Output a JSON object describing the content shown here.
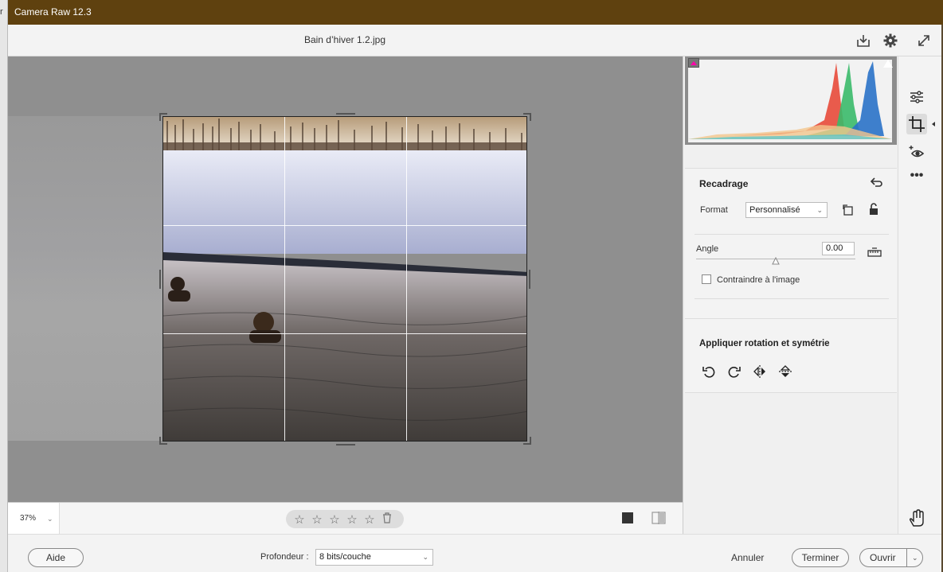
{
  "title_bar": {
    "app_title": "Camera Raw 12.3",
    "edge_char": "r"
  },
  "header": {
    "filename": "Bain d’hiver 1.2.jpg"
  },
  "status": {
    "zoom": "37%",
    "rating_stars": 0
  },
  "crop_panel": {
    "title": "Recadrage",
    "format_label": "Format",
    "format_value": "Personnalisé",
    "angle_label": "Angle",
    "angle_value": "0.00",
    "constrain_label": "Contraindre à l'image",
    "constrain_checked": false,
    "rotate_title": "Appliquer rotation et symétrie"
  },
  "footer": {
    "help": "Aide",
    "depth_label": "Profondeur :",
    "depth_value": "8 bits/couche",
    "cancel": "Annuler",
    "done": "Terminer",
    "open": "Ouvrir"
  },
  "colors": {
    "title_bg": "#5f410f",
    "canvas_bg": "#8f8f8f",
    "panel_bg": "#f3f3f3"
  }
}
